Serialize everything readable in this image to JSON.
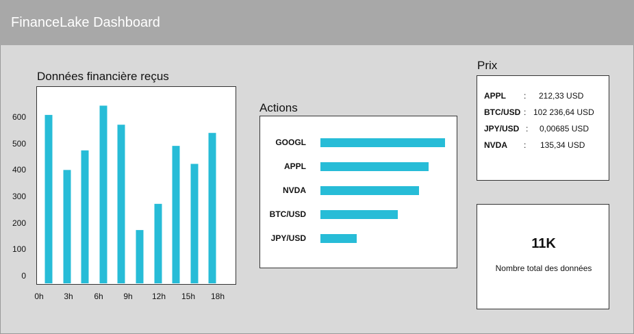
{
  "header": {
    "title": "FinanceLake Dashboard"
  },
  "received_chart": {
    "title": "Données financière reçus"
  },
  "actions_chart": {
    "title": "Actions"
  },
  "prices": {
    "title": "Prix",
    "rows": [
      {
        "symbol": "APPL",
        "sep": ":",
        "value": "212,33 USD"
      },
      {
        "symbol": "BTC/USD",
        "sep": ":",
        "value": "102 236,64 USD"
      },
      {
        "symbol": "JPY/USD",
        "sep": ":",
        "value": "0,00685 USD"
      },
      {
        "symbol": "NVDA",
        "sep": ":",
        "value": "135,34 USD"
      }
    ]
  },
  "kpi": {
    "value": "11K",
    "label": "Nombre total des données"
  },
  "colors": {
    "bar": "#27bcd7",
    "header": "#a8a8a8",
    "background": "#d9d9d9"
  },
  "chart_data": [
    {
      "type": "bar",
      "title": "Données financière reçus",
      "x_tick_labels": [
        "0h",
        "3h",
        "6h",
        "9h",
        "12h",
        "15h",
        "18h"
      ],
      "y_tick_labels": [
        "0",
        "100",
        "200",
        "300",
        "400",
        "500",
        "600"
      ],
      "ylim": [
        0,
        700
      ],
      "values": [
        608,
        400,
        474,
        643,
        571,
        173,
        272,
        491,
        423,
        540
      ],
      "grid": false
    },
    {
      "type": "bar",
      "orientation": "horizontal",
      "title": "Actions",
      "categories": [
        "GOOGL",
        "APPL",
        "NVDA",
        "BTC/USD",
        "JPY/USD"
      ],
      "values": [
        1.0,
        0.87,
        0.79,
        0.62,
        0.29
      ],
      "grid": false
    }
  ]
}
